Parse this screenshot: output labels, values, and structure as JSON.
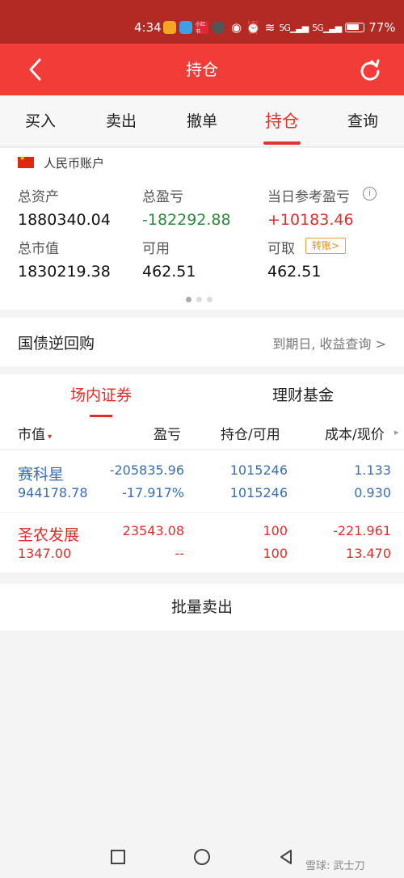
{
  "status_bar": {
    "time": "4:34",
    "apps": [
      {
        "icon": "app-orange-icon",
        "label": "",
        "color": "#f5a623"
      },
      {
        "icon": "app-blue-icon",
        "label": "",
        "color": "#3aa0e8"
      },
      {
        "icon": "app-red-icon",
        "label": "小红书",
        "color": "#e0283b"
      },
      {
        "icon": "app-circle-icon",
        "label": "",
        "color": "#555555"
      }
    ],
    "signal_1": "5G",
    "signal_2": "5G",
    "battery": "77%",
    "battery_level": 0.77
  },
  "nav": {
    "title": "持仓",
    "back_icon": "chevron-left-icon",
    "refresh_icon": "refresh-icon"
  },
  "tabs": [
    {
      "label": "买入",
      "active": false
    },
    {
      "label": "卖出",
      "active": false
    },
    {
      "label": "撤单",
      "active": false
    },
    {
      "label": "持仓",
      "active": true
    },
    {
      "label": "查询",
      "active": false
    }
  ],
  "account": {
    "name": "人民币账户",
    "total_assets_label": "总资产",
    "total_assets": "1880340.04",
    "total_pl_label": "总盈亏",
    "total_pl": "-182292.88",
    "daily_pl_label": "当日参考盈亏",
    "daily_pl": "+10183.46",
    "market_value_label": "总市值",
    "market_value": "1830219.38",
    "available_label": "可用",
    "available": "462.51",
    "withdrawable_label": "可取",
    "withdrawable": "462.51",
    "transfer_label": "转账>",
    "page_count": 3,
    "active_page": 0
  },
  "repo": {
    "title": "国债逆回购",
    "link": "到期日, 收益查询 >"
  },
  "holdings": {
    "tabs": [
      {
        "label": "场内证券",
        "active": true
      },
      {
        "label": "理财基金",
        "active": false
      }
    ],
    "columns": [
      "市值",
      "盈亏",
      "持仓/可用",
      "成本/现价"
    ],
    "rows": [
      {
        "name": "赛科星",
        "market_value": "944178.78",
        "pl": "-205835.96",
        "pl_pct": "-17.917%",
        "position": "1015246",
        "available": "1015246",
        "cost": "1.133",
        "price": "0.930",
        "color": "#3a6fb0"
      },
      {
        "name": "圣农发展",
        "market_value": "1347.00",
        "pl": "23543.08",
        "pl_pct": "--",
        "position": "100",
        "available": "100",
        "cost": "-221.961",
        "price": "13.470",
        "color": "#d9302b"
      }
    ]
  },
  "batch_sell_label": "批量卖出",
  "watermark": "雪球: 武士刀"
}
